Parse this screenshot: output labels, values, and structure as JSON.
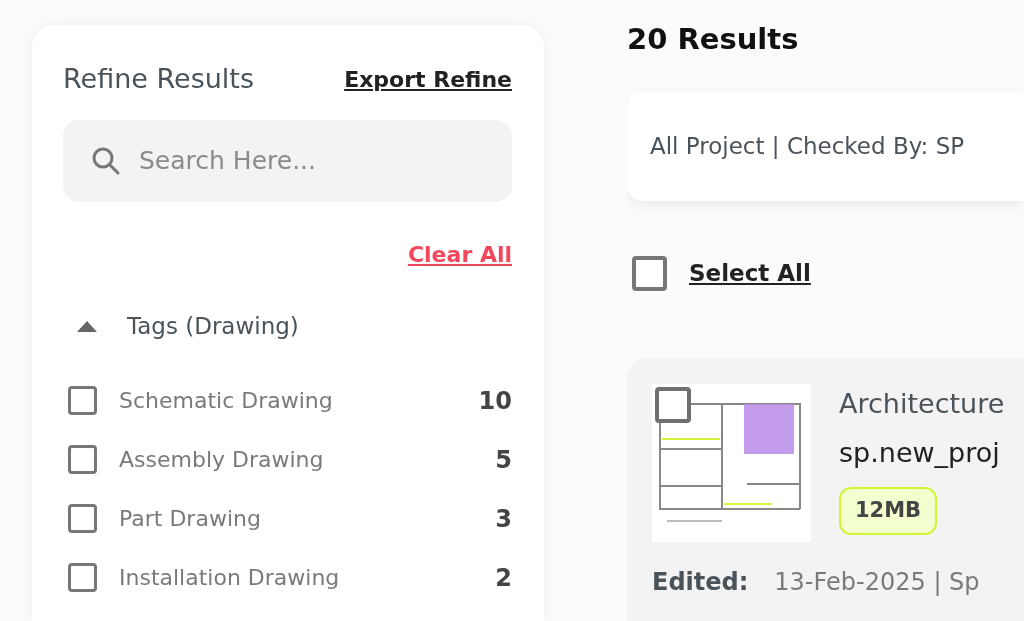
{
  "sidebar": {
    "title": "Refine Results",
    "export_link": "Export Refine",
    "search": {
      "placeholder": "Search Here..."
    },
    "clear_link": "Clear All",
    "filter_group": {
      "title": "Tags (Drawing)",
      "expanded": true,
      "options": [
        {
          "label": "Schematic Drawing",
          "count": "10",
          "checked": false
        },
        {
          "label": "Assembly Drawing",
          "count": "5",
          "checked": false
        },
        {
          "label": "Part Drawing",
          "count": "3",
          "checked": false
        },
        {
          "label": "Installation Drawing",
          "count": "2",
          "checked": false
        }
      ]
    }
  },
  "results": {
    "heading": "20 Results",
    "filter_summary": "All Project | Checked By: SP",
    "select_all": {
      "label": "Select All",
      "checked": false
    },
    "items": [
      {
        "checked": false,
        "title": "Architecture",
        "filename": "sp.new_proj",
        "size": "12MB",
        "edited_label": "Edited:",
        "edited_value": "13-Feb-2025 | Sp"
      }
    ]
  }
}
